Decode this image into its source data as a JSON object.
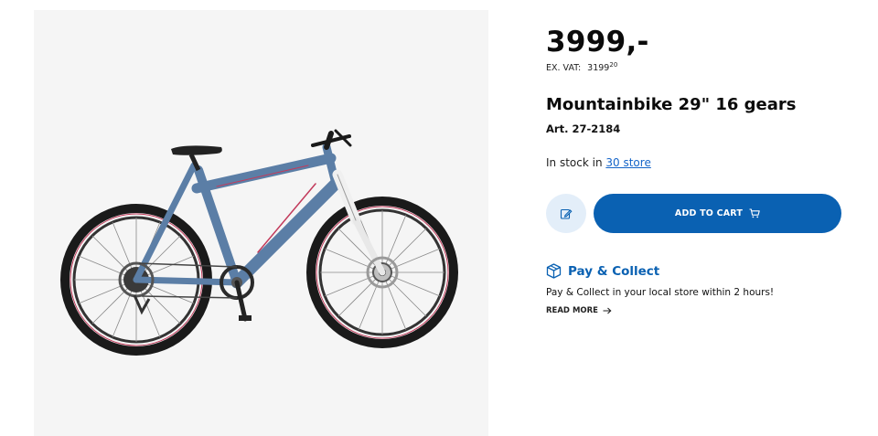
{
  "product": {
    "image_alt": "Mountainbike 29\" 16 gears",
    "price": "3999,-",
    "ex_vat_label": "EX. VAT:",
    "ex_vat_value": "3199",
    "ex_vat_decimals": "20",
    "title": "Mountainbike 29\" 16 gears",
    "article_number": "Art. 27-2184",
    "stock_prefix": "In stock in",
    "stock_link": "30 store"
  },
  "actions": {
    "wishlist_icon": "pencil-note-icon",
    "add_to_cart_label": "ADD TO CART",
    "cart_icon": "shopping-cart-icon"
  },
  "pay_collect": {
    "icon": "box-icon",
    "title": "Pay & Collect",
    "description": "Pay & Collect in your local store within 2 hours!",
    "read_more": "READ MORE"
  },
  "colors": {
    "brand_blue": "#0a61b2",
    "light_blue": "#e3eef9",
    "image_bg": "#f5f5f5"
  }
}
